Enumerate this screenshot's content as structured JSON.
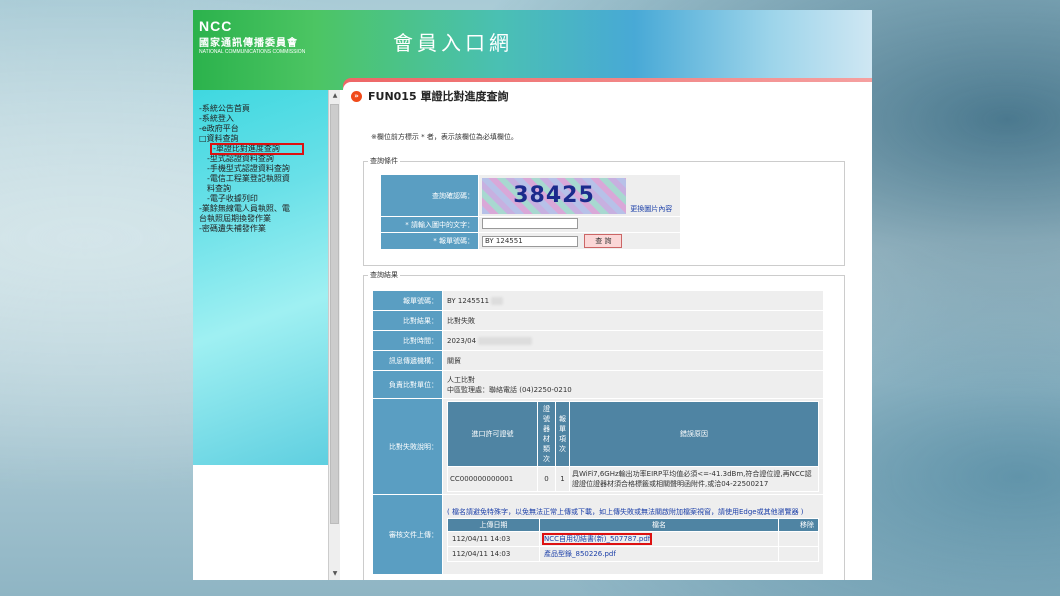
{
  "header": {
    "logo_line1": "NCC",
    "logo_line2": "國家通訊傳播委員會",
    "logo_line3": "NATIONAL COMMUNICATIONS COMMISSION",
    "site_title": "會員入口網"
  },
  "sidebar": {
    "items": [
      {
        "label": "-系統公告首頁",
        "level": 0
      },
      {
        "label": "-系統登入",
        "level": 0
      },
      {
        "label": "-e政府平台",
        "level": 0
      },
      {
        "label": "□資料查詢",
        "level": 0
      },
      {
        "label": "-單證比對進度查詢",
        "level": 1,
        "highlight": true
      },
      {
        "label": "-型式認證資料查詢",
        "level": 1
      },
      {
        "label": "-手機型式認證資料查詢",
        "level": 1
      },
      {
        "label": "-電信工程業登記執照資",
        "level": 1
      },
      {
        "label": "料查詢",
        "level": 1
      },
      {
        "label": "-電子收據列印",
        "level": 1
      },
      {
        "label": "-業餘無線電人員執照、電",
        "level": 0
      },
      {
        "label": "台執照屆期換發作業",
        "level": 0
      },
      {
        "label": "-密碼遺失補發作業",
        "level": 0
      }
    ]
  },
  "page": {
    "fun_title": "FUN015 單證比對進度查詢",
    "note": "※欄位前方標示 * 者，表示該欄位為必填欄位。",
    "query_legend": "查詢條件",
    "result_legend": "查詢結果"
  },
  "query": {
    "captcha_label": "查詢確認碼：",
    "captcha_value": "38425",
    "refresh_link": "更換圖片內容",
    "input_label": "* 請輸入圖中的文字：",
    "input_value": "",
    "bill_label": "* 報單號碼：",
    "bill_value": "BY 124551",
    "search_button": "查 詢"
  },
  "result": {
    "rows": [
      {
        "label": "報單號碼：",
        "value": "BY 1245511"
      },
      {
        "label": "比對結果：",
        "value": "比對失敗"
      },
      {
        "label": "比對時間：",
        "value": "2023/04"
      },
      {
        "label": "訊息傳遞機構：",
        "value": "關貿"
      }
    ],
    "handler_label": "負責比對單位：",
    "handler_line1": "人工比對",
    "handler_line2": "中區監理處：聯絡電話 (04)2250-0210",
    "fail_label": "比對失敗說明：",
    "fail_headers": [
      "進口許可證號",
      "證號器材類次",
      "報單項次",
      "錯誤原因"
    ],
    "fail_row": {
      "permit": "CC000000000001",
      "class": "0",
      "item": "1",
      "reason": "具WiFi7,6GHz輸出功率EIRP平均值必須<=-41.3dBm,符合證位證,再NCC認證證位證器材須合格標籤或相關聲明函附件,或洽04-22500217"
    },
    "upload_label": "審核文件上傳：",
    "upload_note": "( 檔名請避免特殊字，以免無法正常上傳或下載，如上傳失敗或無法關啟附加檔案視窗，請使用Edge或其他瀏覽器 )",
    "upload_headers": [
      "上傳日期",
      "檔名",
      "移除"
    ],
    "uploads": [
      {
        "date": "112/04/11 14:03",
        "file": "NCC自用切結書(新)_507787.pdf"
      },
      {
        "date": "112/04/11 14:03",
        "file": "產品型錄_850226.pdf"
      }
    ]
  }
}
